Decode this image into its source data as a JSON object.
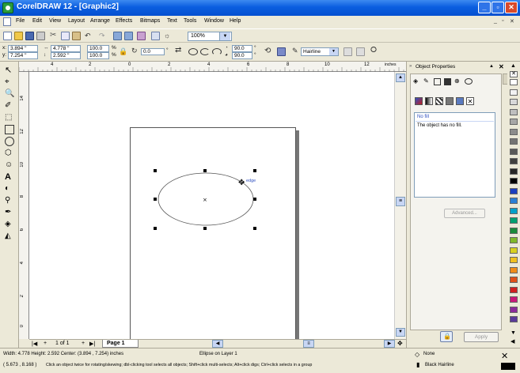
{
  "window": {
    "title": "CorelDRAW 12 - [Graphic2]"
  },
  "menu": [
    "File",
    "Edit",
    "View",
    "Layout",
    "Arrange",
    "Effects",
    "Bitmaps",
    "Text",
    "Tools",
    "Window",
    "Help"
  ],
  "toolbar": {
    "zoom": "100%"
  },
  "property_bar": {
    "x_label": "x:",
    "x": "3.894 \"",
    "y_label": "y:",
    "y": "7.254 \"",
    "w": "4.778 \"",
    "h": "2.592 \"",
    "scale_w": "100.0",
    "scale_h": "100.0",
    "pct": "%",
    "rotation": "0.0",
    "deg": "°",
    "angle_start": "90.0",
    "angle_end": "90.0",
    "outline": "Hairline"
  },
  "ruler": {
    "units": "inches",
    "top_ticks": [
      "4",
      "2",
      "0",
      "2",
      "4",
      "6",
      "8",
      "10",
      "12"
    ],
    "left_ticks": [
      "14",
      "12",
      "10",
      "8",
      "6",
      "4",
      "2",
      "0"
    ]
  },
  "canvas": {
    "cursor_label": "edge"
  },
  "page_nav": {
    "counter": "1 of 1",
    "tab": "Page 1"
  },
  "docker": {
    "title": "Object Properties",
    "fill_type": "No fill",
    "fill_desc": "The object has no fill.",
    "advanced": "Advanced...",
    "apply": "Apply"
  },
  "status": {
    "dims": "Width: 4.778  Height: 2.592  Center: (3.894 , 7.254)  inches",
    "object": "Ellipse on Layer 1",
    "coords": "( 5.673 , 8.168 )",
    "hint": "Click an object twice for rotating/skewing; dbl-clicking tool selects all objects; Shift+click multi-selects; Alt+click digs; Ctrl+click selects in a group",
    "fill_status": "None",
    "outline_status": "Black  Hairline"
  },
  "palette": [
    "#ffffff",
    "#f2f2f2",
    "#d9d9d9",
    "#bfbfbf",
    "#a6a6a6",
    "#8c8c8c",
    "#737373",
    "#595959",
    "#404040",
    "#262626",
    "#000000",
    "#1a3fbf",
    "#2a7fd4",
    "#00a0c8",
    "#00a070",
    "#1a8a3a",
    "#7fb82a",
    "#d8d020",
    "#f0c020",
    "#f08c18",
    "#e05018",
    "#d02020",
    "#c8187a",
    "#8a2a9a",
    "#5a3a9a"
  ]
}
